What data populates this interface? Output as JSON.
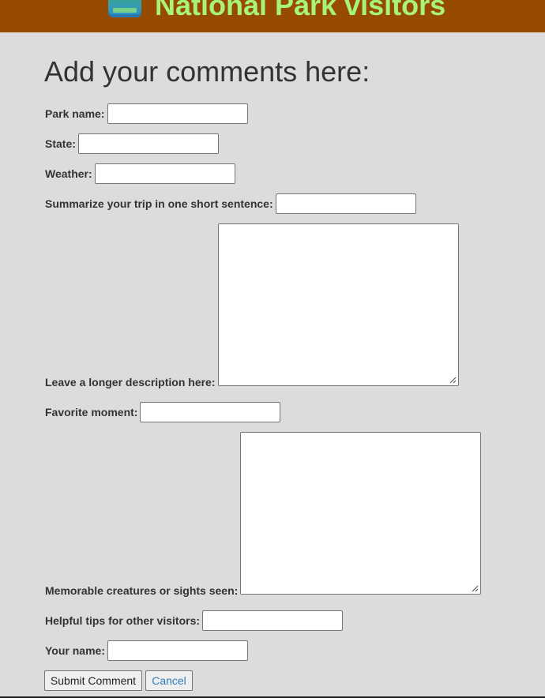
{
  "header": {
    "title": "National Park visitors",
    "background_color": "#964b00",
    "title_color": "#a6f57a",
    "logo_icon": "park-logo-icon"
  },
  "page": {
    "heading": "Add your comments here:",
    "background_color": "#dcdcdc"
  },
  "form": {
    "park_name_label": "Park name:",
    "state_label": "State:",
    "weather_label": "Weather:",
    "summary_label": "Summarize your trip in one short sentence:",
    "description_label": "Leave a longer description here:",
    "favorite_moment_label": "Favorite moment:",
    "creatures_label": "Memorable creatures or sights seen:",
    "tips_label": "Helpful tips for other visitors:",
    "your_name_label": "Your name:"
  },
  "actions": {
    "submit_label": "Submit Comment",
    "cancel_label": "Cancel",
    "cancel_color": "#337ab7"
  }
}
